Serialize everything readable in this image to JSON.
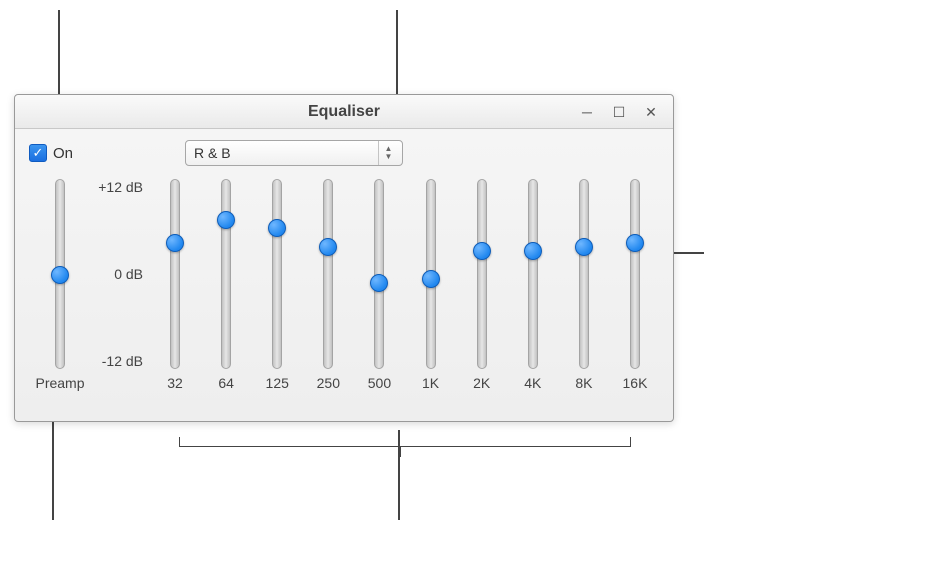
{
  "window": {
    "title": "Equaliser"
  },
  "controls": {
    "on_label": "On",
    "on_checked": true,
    "preset_value": "R & B"
  },
  "db_labels": {
    "max": "+12 dB",
    "mid": "0 dB",
    "min": "-12 dB"
  },
  "preamp": {
    "label": "Preamp",
    "value_db": 0
  },
  "bands": [
    {
      "freq_label": "32",
      "value_db": 4.0
    },
    {
      "freq_label": "64",
      "value_db": 7.0
    },
    {
      "freq_label": "125",
      "value_db": 6.0
    },
    {
      "freq_label": "250",
      "value_db": 3.5
    },
    {
      "freq_label": "500",
      "value_db": -1.0
    },
    {
      "freq_label": "1K",
      "value_db": -0.5
    },
    {
      "freq_label": "2K",
      "value_db": 3.0
    },
    {
      "freq_label": "4K",
      "value_db": 3.0
    },
    {
      "freq_label": "8K",
      "value_db": 3.5
    },
    {
      "freq_label": "16K",
      "value_db": 4.0
    }
  ],
  "colors": {
    "accent": "#2087ef"
  }
}
